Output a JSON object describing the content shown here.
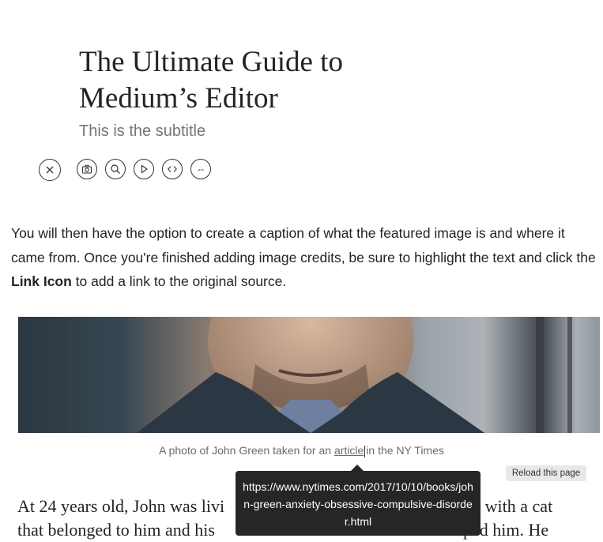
{
  "post": {
    "title_line1": "The Ultimate Guide to",
    "title_line2": "Medium’s Editor",
    "subtitle": "This is the subtitle"
  },
  "toolbar": {
    "icons": [
      "close-icon",
      "camera-icon",
      "search-icon",
      "play-icon",
      "code-icon",
      "divider-icon"
    ],
    "divider_glyph": "--"
  },
  "paragraph": {
    "part1": "You will then have the option to create a caption of what the featured image is and where it came from. Once you're finished adding image credits, be sure to highlight the text and click the ",
    "bold": "Link Icon",
    "part2": " to add a link to the original source."
  },
  "caption": {
    "before": "A photo of John Green taken for an ",
    "link": "article",
    "after": "in the NY Times"
  },
  "tooltip": {
    "url": "https://www.nytimes.com/2017/10/10/books/john-green-anxiety-obsessive-compulsive-disorder.html"
  },
  "reload_button": "Reload this page",
  "story": {
    "line1_start": "At 24 years old, John was livi",
    "line1_end": "go with a cat",
    "line2_start": "that belonged to him and his",
    "line2_end": "umped him. He"
  }
}
